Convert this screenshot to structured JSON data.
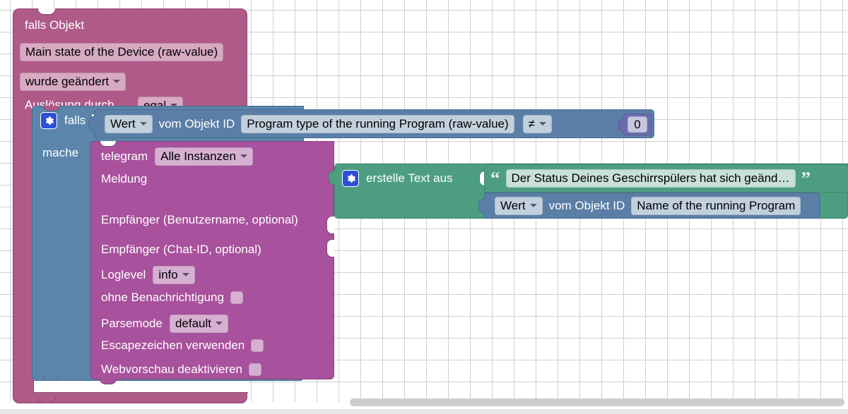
{
  "workspace": {
    "name": "blockly-workspace",
    "background_color": "#ffffff",
    "grid_color": "#cfcfd4"
  },
  "trigger_block": {
    "title": "falls Objekt",
    "color": "#b05a8a",
    "object_field": "Main state of the Device (raw-value)",
    "change_mode": "wurde geändert",
    "ack_label": "Auslösung durch",
    "ack_value": "egal"
  },
  "if_block": {
    "color": "#5b85ab",
    "gear_icon": "gear-icon",
    "if_label": "falls",
    "do_label": "mache"
  },
  "condition": {
    "color": "#5b7ea6",
    "mode": "Wert",
    "prefix": "vom Objekt ID",
    "object_id": "Program type of the running Program (raw-value)",
    "operator": "≠",
    "compare_value": "0",
    "compare_color": "#6b6bb0"
  },
  "telegram_block": {
    "color": "#a8519c",
    "name": "telegram",
    "instance": "Alle Instanzen",
    "message_label": "Meldung",
    "recipient_user_label": "Empfänger (Benutzername, optional)",
    "recipient_chat_label": "Empfänger (Chat-ID, optional)",
    "loglevel_label": "Loglevel",
    "loglevel_value": "info",
    "silent_label": "ohne Benachrichtigung",
    "parsemode_label": "Parsemode",
    "parsemode_value": "default",
    "escape_label": "Escapezeichen verwenden",
    "webpreview_label": "Webvorschau deaktivieren"
  },
  "text_block": {
    "color": "#4d9e81",
    "gear_icon": "gear-icon",
    "label": "erstelle Text aus",
    "open_quote": "“",
    "close_quote": "”",
    "string_value": "Der Status Deines Geschirrspülers hat sich geänd…",
    "getvalue": {
      "mode": "Wert",
      "prefix": "vom Objekt ID",
      "object_id": "Name of the running Program",
      "color": "#5b7ea6"
    }
  },
  "scrollbar": {
    "name": "horizontal-scrollbar",
    "color": "#cdcdcd"
  }
}
